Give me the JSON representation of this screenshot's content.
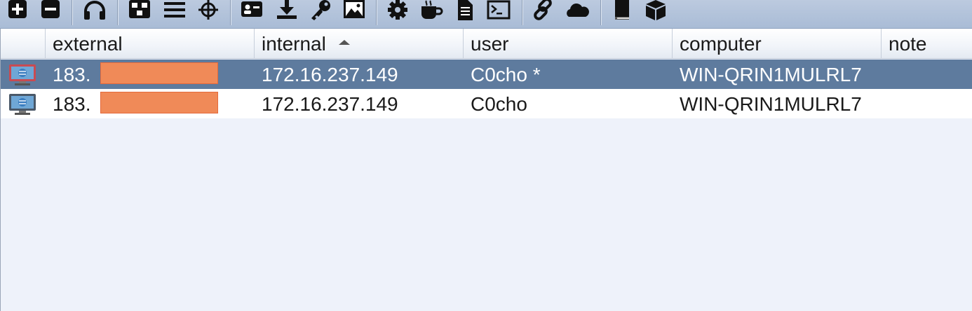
{
  "toolbar": {
    "buttons": [
      {
        "icon": "plus-square-icon",
        "name": "new-connection-button"
      },
      {
        "icon": "minus-square-icon",
        "name": "disconnect-button"
      },
      {
        "icon": "headphones-icon",
        "name": "listeners-button"
      },
      {
        "icon": "pivot-graph-icon",
        "name": "pivot-graph-button"
      },
      {
        "icon": "session-list-icon",
        "name": "session-table-button"
      },
      {
        "icon": "crosshair-icon",
        "name": "targets-button"
      },
      {
        "icon": "id-card-icon",
        "name": "credentials-button"
      },
      {
        "icon": "download-icon",
        "name": "downloads-button"
      },
      {
        "icon": "key-icon",
        "name": "keystrokes-button"
      },
      {
        "icon": "image-icon",
        "name": "screenshots-button"
      },
      {
        "icon": "gear-icon",
        "name": "payload-generator-button"
      },
      {
        "icon": "coffee-icon",
        "name": "java-payload-button"
      },
      {
        "icon": "document-icon",
        "name": "ms-office-macro-button"
      },
      {
        "icon": "terminal-icon",
        "name": "scripted-web-delivery-button"
      },
      {
        "icon": "link-icon",
        "name": "host-file-button"
      },
      {
        "icon": "cloud-icon",
        "name": "manage-web-sites-button"
      },
      {
        "icon": "book-icon",
        "name": "help-button"
      },
      {
        "icon": "package-icon",
        "name": "about-button"
      }
    ]
  },
  "table": {
    "columns": [
      {
        "key": "external",
        "label": "external"
      },
      {
        "key": "internal",
        "label": "internal",
        "sorted": "ascending"
      },
      {
        "key": "user",
        "label": "user"
      },
      {
        "key": "computer",
        "label": "computer"
      },
      {
        "key": "note",
        "label": "note"
      }
    ],
    "rows": [
      {
        "selected": true,
        "icon": "windows-session-icon",
        "external": "183.",
        "internal": "172.16.237.149",
        "user": "C0cho *",
        "computer": "WIN-QRIN1MULRL7",
        "note": ""
      },
      {
        "selected": false,
        "icon": "windows-session-icon",
        "external": "183.",
        "internal": "172.16.237.149",
        "user": "C0cho",
        "computer": "WIN-QRIN1MULRL7",
        "note": ""
      }
    ]
  },
  "colors": {
    "toolbar_bg": "#b3c3da",
    "selected_row": "#5e7b9e",
    "redaction": "#f08a58",
    "table_bg": "#eef2fa"
  }
}
